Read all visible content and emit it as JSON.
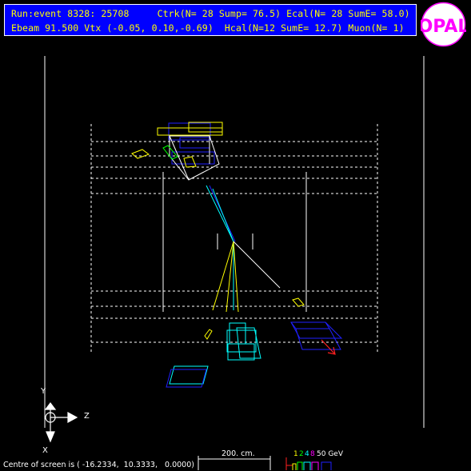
{
  "header": {
    "line1": "Run:event 8328: 25708     Ctrk(N= 28 Sump= 76.5) Ecal(N= 28 SumE= 58.0)",
    "line2": "Ebeam 91.500 Vtx (-0.05, 0.10,-0.69)  Hcal(N=12 SumE= 12.7) Muon(N= 1)"
  },
  "logo": {
    "text": "OPAL"
  },
  "axes": {
    "y": "Y",
    "z": "Z",
    "x": "X"
  },
  "footer": {
    "centre": "Centre of screen is ( -16.2334,  10.3333,   0.0000)",
    "scale": "200. cm.",
    "energy_digits": [
      "1",
      "2",
      "4",
      "8"
    ],
    "energy_max": "50 GeV"
  },
  "colors": {
    "header_bg": "#0000ff",
    "header_text": "#ffff00",
    "track_yellow": "#ffff00",
    "track_cyan": "#00ffff",
    "ecal_blue": "#2020ff",
    "muon_red": "#ff2020",
    "logo_magenta": "#ff00ff"
  }
}
